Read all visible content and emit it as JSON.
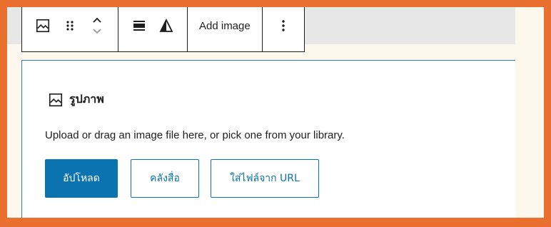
{
  "toolbar": {
    "block_type_icon": "image-icon",
    "drag_icon": "drag-handle-icon",
    "move_icon": "chevron-up-down-icon",
    "align_icon": "align-icon",
    "duotone_icon": "duotone-filter-icon",
    "add_image_label": "Add image",
    "options_icon": "more-vertical-icon"
  },
  "block": {
    "title_icon": "image-icon",
    "title": "รูปภาพ",
    "instructions": "Upload or drag an image file here, or pick one from your library.",
    "upload_label": "อัปโหลด",
    "media_library_label": "คลังสื่อ",
    "insert_url_label": "ใส่ไฟล์จาก URL"
  },
  "colors": {
    "frame": "#ea7030",
    "accent": "#0a73b0",
    "focus_border": "#2f7fbf"
  }
}
